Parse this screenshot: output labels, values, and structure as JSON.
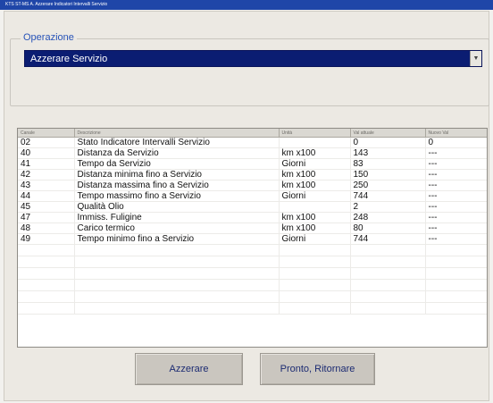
{
  "window": {
    "title": "KTS ST-MS A. Azzerare Indicatori Intervalli Servizio"
  },
  "operation": {
    "label": "Operazione",
    "selected": "Azzerare Servizio"
  },
  "table": {
    "headers": [
      "Canale",
      "Descrizione",
      "Unità",
      "Val attuale",
      "Nuovo Val"
    ],
    "rows": [
      {
        "canale": "02",
        "descrizione": "Stato Indicatore Intervalli Servizio",
        "unita": "",
        "val_attuale": "0",
        "nuovo_val": "0"
      },
      {
        "canale": "40",
        "descrizione": "Distanza da Servizio",
        "unita": "km x100",
        "val_attuale": "143",
        "nuovo_val": "---"
      },
      {
        "canale": "41",
        "descrizione": "Tempo da Servizio",
        "unita": "Giorni",
        "val_attuale": "83",
        "nuovo_val": "---"
      },
      {
        "canale": "42",
        "descrizione": "Distanza minima fino a Servizio",
        "unita": "km x100",
        "val_attuale": "150",
        "nuovo_val": "---"
      },
      {
        "canale": "43",
        "descrizione": "Distanza massima fino a Servizio",
        "unita": "km x100",
        "val_attuale": "250",
        "nuovo_val": "---"
      },
      {
        "canale": "44",
        "descrizione": "Tempo massimo fino a Servizio",
        "unita": "Giorni",
        "val_attuale": "744",
        "nuovo_val": "---"
      },
      {
        "canale": "45",
        "descrizione": "Qualità Olio",
        "unita": "",
        "val_attuale": "2",
        "nuovo_val": "---"
      },
      {
        "canale": "47",
        "descrizione": "Immiss. Fuligine",
        "unita": "km x100",
        "val_attuale": "248",
        "nuovo_val": "---"
      },
      {
        "canale": "48",
        "descrizione": "Carico termico",
        "unita": "km x100",
        "val_attuale": "80",
        "nuovo_val": "---"
      },
      {
        "canale": "49",
        "descrizione": "Tempo minimo fino a Servizio",
        "unita": "Giorni",
        "val_attuale": "744",
        "nuovo_val": "---"
      }
    ]
  },
  "buttons": {
    "reset": "Azzerare",
    "ready_return": "Pronto, Ritornare"
  },
  "colors": {
    "title_bar": "#1f46a8",
    "selection": "#0b1d72",
    "group_label": "#2753b8",
    "button_text": "#1c2b72"
  }
}
